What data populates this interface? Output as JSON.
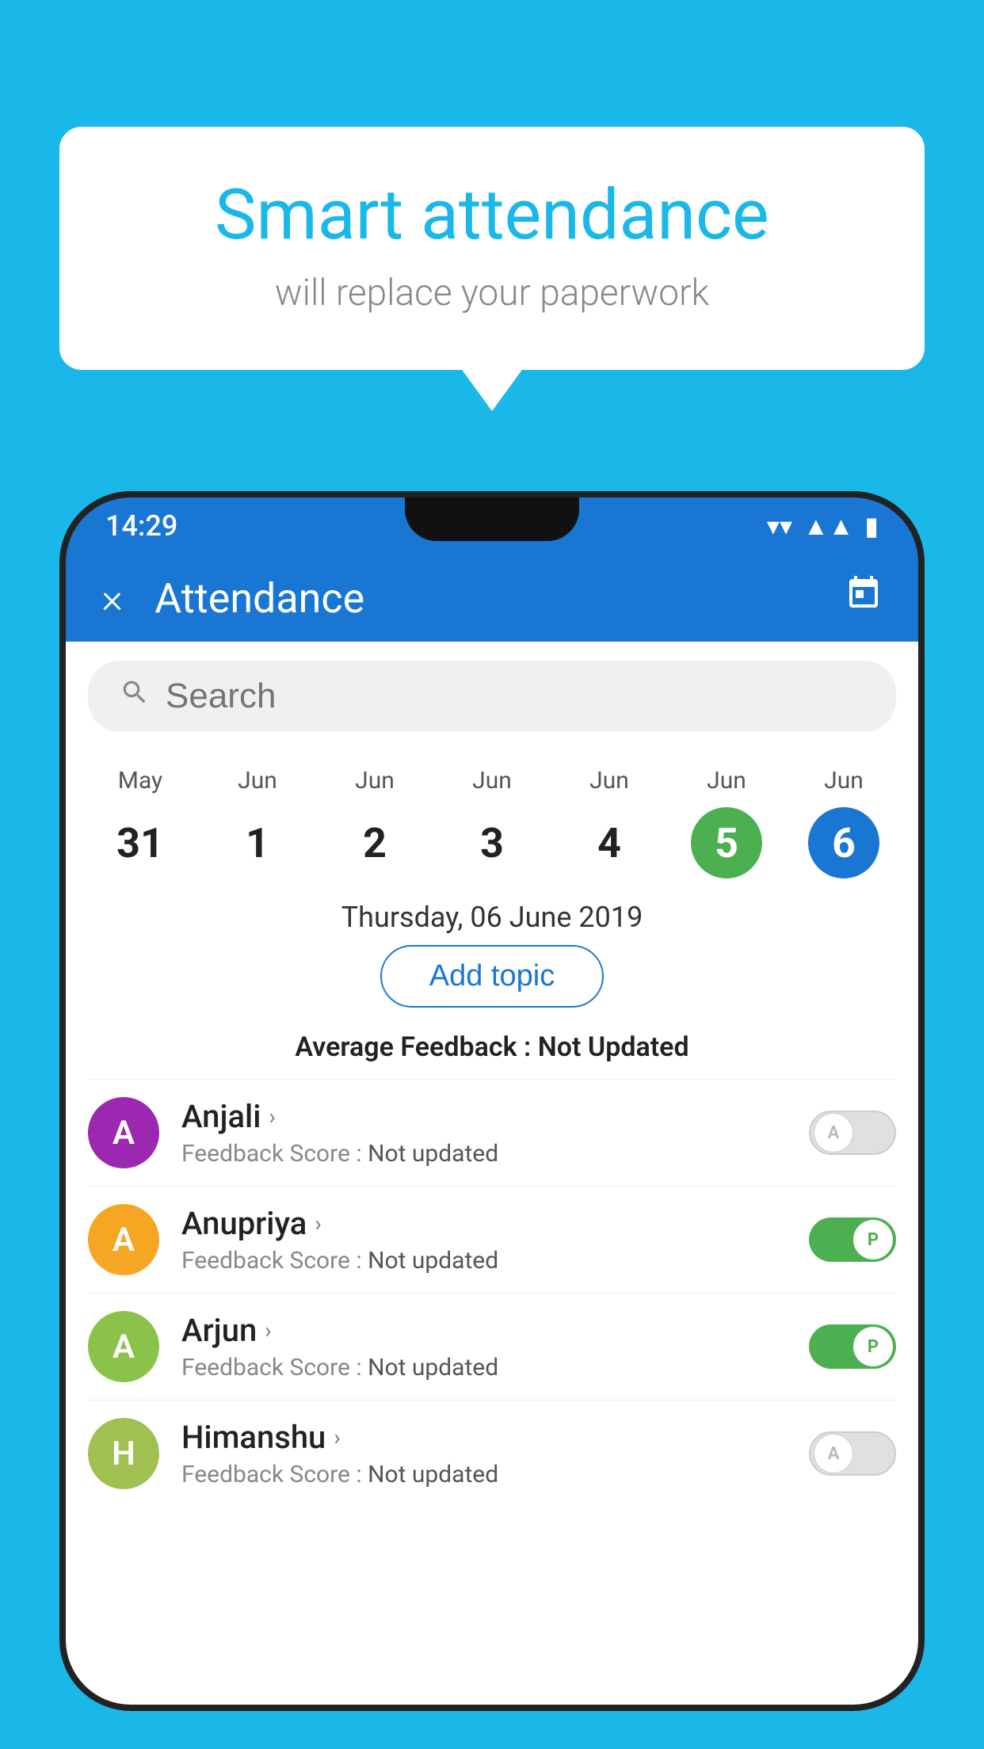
{
  "background_color": "#1ab8e8",
  "bubble": {
    "title": "Smart attendance",
    "subtitle": "will replace your paperwork"
  },
  "status_bar": {
    "time": "14:29",
    "icons": [
      "wifi",
      "signal",
      "battery"
    ]
  },
  "app_bar": {
    "title": "Attendance",
    "close_label": "×",
    "calendar_label": "📅"
  },
  "search": {
    "placeholder": "Search"
  },
  "dates": [
    {
      "month": "May",
      "day": "31",
      "style": "normal"
    },
    {
      "month": "Jun",
      "day": "1",
      "style": "normal"
    },
    {
      "month": "Jun",
      "day": "2",
      "style": "normal"
    },
    {
      "month": "Jun",
      "day": "3",
      "style": "normal"
    },
    {
      "month": "Jun",
      "day": "4",
      "style": "normal"
    },
    {
      "month": "Jun",
      "day": "5",
      "style": "green"
    },
    {
      "month": "Jun",
      "day": "6",
      "style": "blue"
    }
  ],
  "selected_date": "Thursday, 06 June 2019",
  "add_topic_label": "Add topic",
  "avg_feedback": {
    "label": "Average Feedback : ",
    "value": "Not Updated"
  },
  "students": [
    {
      "name": "Anjali",
      "avatar_letter": "A",
      "avatar_class": "avatar-purple",
      "feedback_label": "Feedback Score : ",
      "feedback_value": "Not updated",
      "toggle": "off",
      "toggle_label": "A"
    },
    {
      "name": "Anupriya",
      "avatar_letter": "A",
      "avatar_class": "avatar-yellow",
      "feedback_label": "Feedback Score : ",
      "feedback_value": "Not updated",
      "toggle": "on",
      "toggle_label": "P"
    },
    {
      "name": "Arjun",
      "avatar_letter": "A",
      "avatar_class": "avatar-green-light",
      "feedback_label": "Feedback Score : ",
      "feedback_value": "Not updated",
      "toggle": "on",
      "toggle_label": "P"
    },
    {
      "name": "Himanshu",
      "avatar_letter": "H",
      "avatar_class": "avatar-olive",
      "feedback_label": "Feedback Score : ",
      "feedback_value": "Not updated",
      "toggle": "off",
      "toggle_label": "A"
    }
  ]
}
